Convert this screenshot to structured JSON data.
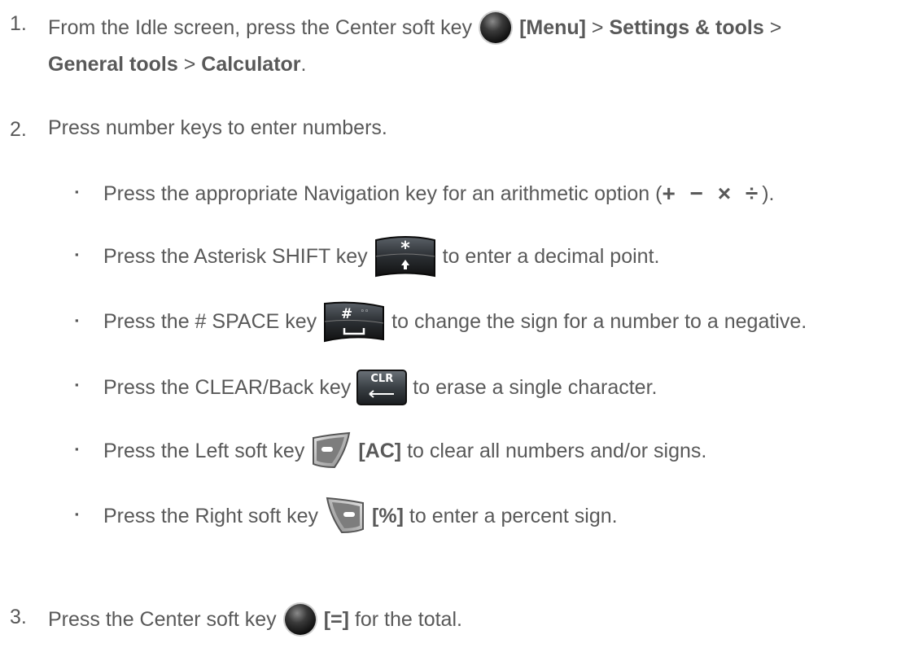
{
  "steps": [
    {
      "number": "1.",
      "line1_text": "From the Idle screen, press the Center soft key",
      "line1_bold1": "[Menu]",
      "sep1": " > ",
      "line1_bold2": "Settings & tools",
      "sep2": " >",
      "line2_bold1": "General tools",
      "sep3": " > ",
      "line2_bold2": "Calculator",
      "line2_end": ".",
      "key_icon": "center-soft-key-icon"
    },
    {
      "number": "2.",
      "text": "Press number keys to enter numbers."
    },
    {
      "number": "3.",
      "text_before": "Press the Center soft key",
      "bold": "[=]",
      "text_after": "for the total.",
      "key_icon": "center-soft-key-icon"
    }
  ],
  "bullets": [
    {
      "text_before": "Press the appropriate Navigation key for an arithmetic option (",
      "ops": "+ − × ÷",
      "text_after": ")."
    },
    {
      "text_before": "Press the Asterisk SHIFT key",
      "text_after": "to enter a decimal point.",
      "key_icon": "asterisk-shift-key-icon"
    },
    {
      "text_before": "Press the # SPACE key",
      "text_after": "to change the sign for a number to a negative.",
      "key_icon": "hash-space-key-icon"
    },
    {
      "text_before": "Press the CLEAR/Back key",
      "key_label": "CLR",
      "text_after": "to erase a single character.",
      "key_icon": "clear-back-key-icon"
    },
    {
      "text_before": "Press the Left soft key",
      "bold": "[AC]",
      "text_after": "to clear all numbers and/or signs.",
      "key_icon": "left-soft-key-icon"
    },
    {
      "text_before": "Press the Right soft key",
      "bold": "[%]",
      "text_after": "to enter a percent sign.",
      "key_icon": "right-soft-key-icon"
    }
  ],
  "bullet_glyph": "▪",
  "colors": {
    "text": "#595959",
    "key_dark": "#1f1f1f",
    "key_grey": "#3a3f44"
  }
}
